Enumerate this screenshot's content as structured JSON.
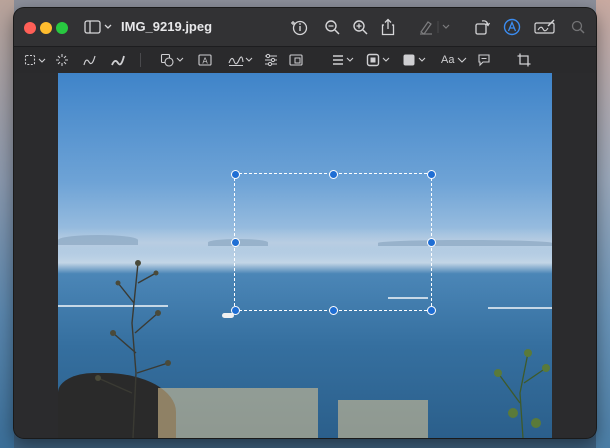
{
  "window": {
    "title": "IMG_9219.jpeg",
    "controls": [
      "close",
      "minimize",
      "zoom"
    ]
  },
  "toolbar": {
    "sidebar_toggle": "sidebar-icon",
    "items": [
      {
        "name": "info-icon"
      },
      {
        "name": "zoom-out-icon"
      },
      {
        "name": "zoom-in-icon"
      },
      {
        "name": "share-icon"
      },
      {
        "name": "highlight-icon"
      },
      {
        "name": "rotate-icon"
      },
      {
        "name": "markup-icon",
        "active": true
      },
      {
        "name": "signature-icon"
      },
      {
        "name": "search-icon"
      }
    ]
  },
  "markup": {
    "text_style_label": "Aa"
  },
  "colors": {
    "window_bg": "#2b2b2d",
    "titlebar_bg": "#323234",
    "accent": "#1f6ed4",
    "close": "#ff5f57",
    "minimize": "#febc2e",
    "zoom": "#28c840"
  },
  "image": {
    "description_icon": "photo-sea-landscape"
  }
}
